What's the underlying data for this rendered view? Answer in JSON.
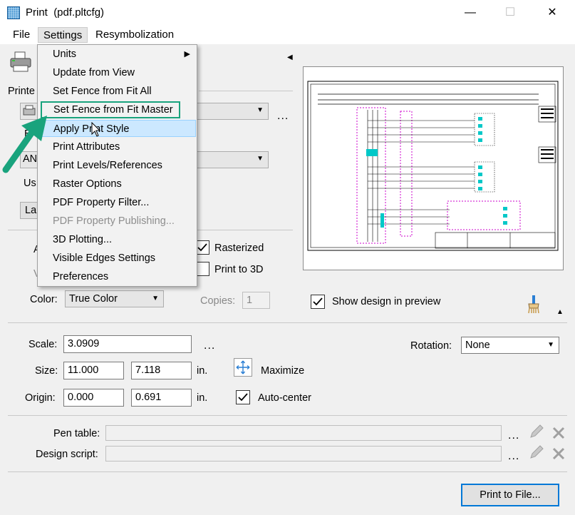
{
  "window": {
    "title": "Print",
    "subtitle": "(pdf.pltcfg)",
    "minimize_glyph": "—",
    "maximize_glyph": "☐",
    "close_glyph": "✕"
  },
  "menubar": {
    "file": "File",
    "settings": "Settings",
    "resymbolization": "Resymbolization"
  },
  "settings_menu": {
    "items": [
      {
        "label": "Units",
        "has_submenu": true,
        "enabled": true
      },
      {
        "label": "Update from View",
        "enabled": true
      },
      {
        "label": "Set Fence from Fit All",
        "enabled": true
      },
      {
        "label": "Set Fence from Fit Master",
        "enabled": true,
        "highlighted": true
      },
      {
        "label": "Apply Print Style",
        "enabled": true,
        "hover": true
      },
      {
        "label": "Print Attributes",
        "enabled": true
      },
      {
        "label": "Print Levels/References",
        "enabled": true
      },
      {
        "label": "Raster Options",
        "enabled": true
      },
      {
        "label": "PDF Property Filter...",
        "enabled": true
      },
      {
        "label": "PDF Property Publishing...",
        "enabled": false
      },
      {
        "label": "3D Plotting...",
        "enabled": true
      },
      {
        "label": "Visible Edges Settings",
        "enabled": true
      },
      {
        "label": "Preferences",
        "enabled": true
      }
    ],
    "submenu_arrow": "▶"
  },
  "printer": {
    "label_partial": "Printe",
    "paper_label_partial": "B",
    "paper_value_partial": "AN",
    "usable_label_partial": "Us",
    "layout_button_partial": "La",
    "more_button": "..."
  },
  "options": {
    "rasterized_label": "Rasterized",
    "rasterized_checked": true,
    "print_to_3d_label": "Print to 3D",
    "print_to_3d_checked": false,
    "left_a_partial": "A",
    "left_v_partial": "V"
  },
  "color": {
    "label": "Color:",
    "value": "True Color"
  },
  "copies": {
    "label": "Copies:",
    "value": "1"
  },
  "show_preview": {
    "label": "Show design in preview",
    "checked": true
  },
  "scale": {
    "label": "Scale:",
    "value": "3.0909",
    "more": "..."
  },
  "rotation": {
    "label": "Rotation:",
    "value": "None"
  },
  "size": {
    "label": "Size:",
    "width": "11.000",
    "height": "7.118",
    "unit": "in."
  },
  "maximize": {
    "label": "Maximize"
  },
  "origin": {
    "label": "Origin:",
    "x": "0.000",
    "y": "0.691",
    "unit": "in."
  },
  "auto_center": {
    "label": "Auto-center",
    "checked": true
  },
  "pen_table": {
    "label": "Pen table:",
    "value": "",
    "more": "..."
  },
  "design_script": {
    "label": "Design script:",
    "value": "",
    "more": "..."
  },
  "print_button": {
    "label": "Print to File..."
  },
  "colors": {
    "accent": "#0078d7",
    "highlight_box": "#19a37d",
    "arrow": "#19a37d",
    "preview_magenta": "#cc00cc",
    "preview_cyan": "#00c8c8"
  }
}
